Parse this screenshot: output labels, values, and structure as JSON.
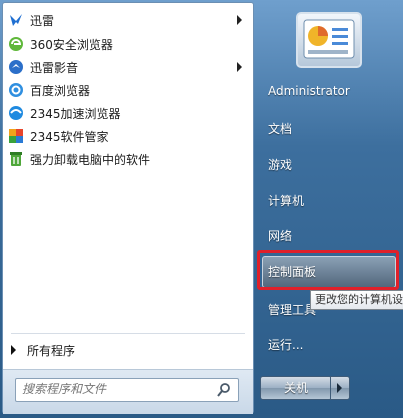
{
  "programs": [
    {
      "label": "迅雷",
      "icon": "xunlei-bird-icon",
      "has_submenu": true
    },
    {
      "label": "360安全浏览器",
      "icon": "360-browser-icon",
      "has_submenu": false
    },
    {
      "label": "迅雷影音",
      "icon": "xunlei-player-icon",
      "has_submenu": true
    },
    {
      "label": "百度浏览器",
      "icon": "baidu-browser-icon",
      "has_submenu": false
    },
    {
      "label": "2345加速浏览器",
      "icon": "2345-browser-icon",
      "has_submenu": false
    },
    {
      "label": "2345软件管家",
      "icon": "2345-software-manager-icon",
      "has_submenu": false
    },
    {
      "label": "强力卸载电脑中的软件",
      "icon": "uninstall-icon",
      "has_submenu": false
    }
  ],
  "all_programs_label": "所有程序",
  "search": {
    "placeholder": "搜索程序和文件"
  },
  "right_items": [
    {
      "label": "Administrator"
    },
    {
      "label": "文档"
    },
    {
      "label": "游戏"
    },
    {
      "label": "计算机"
    },
    {
      "label": "网络"
    },
    {
      "label": "控制面板"
    },
    {
      "label": "管理工具"
    },
    {
      "label": "运行..."
    }
  ],
  "tooltip": "更改您的计算机设",
  "shutdown_label": "关机",
  "colors": {
    "highlight_box": "#e0202a",
    "panel_blue": "#2a5a86"
  }
}
